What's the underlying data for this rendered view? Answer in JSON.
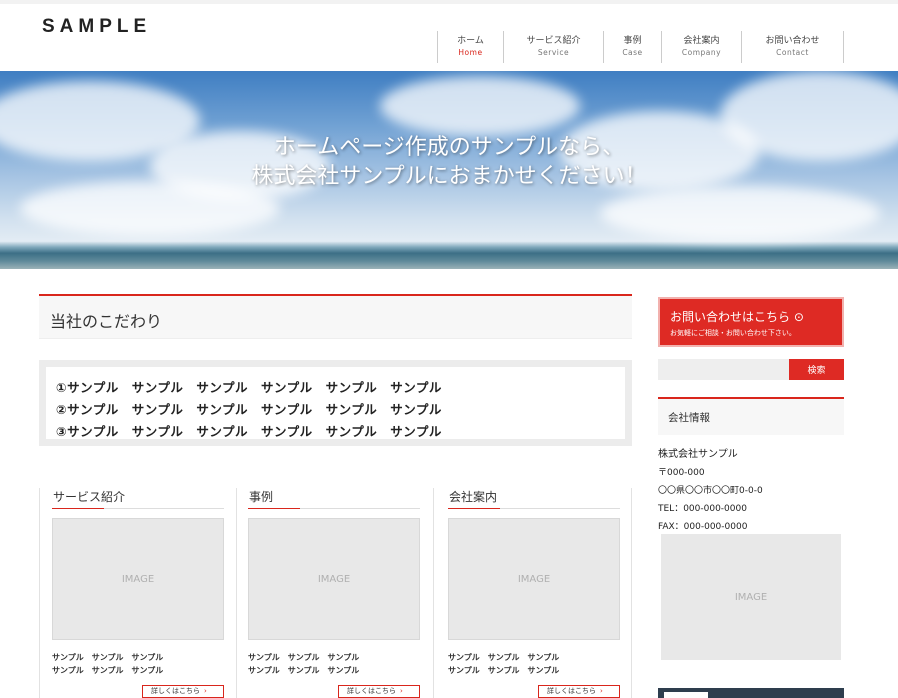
{
  "header": {
    "logo": "SAMPLE",
    "nav": [
      {
        "jp": "ホーム",
        "en": "Home",
        "active": true
      },
      {
        "jp": "サービス紹介",
        "en": "Service",
        "active": false
      },
      {
        "jp": "事例",
        "en": "Case",
        "active": false
      },
      {
        "jp": "会社案内",
        "en": "Company",
        "active": false
      },
      {
        "jp": "お問い合わせ",
        "en": "Contact",
        "active": false
      }
    ]
  },
  "hero": {
    "line1": "ホームページ作成のサンプルなら、",
    "line2": "株式会社サンプルにおまかせください！"
  },
  "main": {
    "section_title": "当社のこだわり",
    "sample_lines": [
      "①サンプル　サンプル　サンプル　サンプル　サンプル　サンプル",
      "②サンプル　サンプル　サンプル　サンプル　サンプル　サンプル",
      "③サンプル　サンプル　サンプル　サンプル　サンプル　サンプル"
    ],
    "columns": [
      {
        "title": "サービス紹介",
        "image": "IMAGE",
        "text1": "サンプル　サンプル　サンプル",
        "text2": "サンプル　サンプル　サンプル",
        "more": "詳しくはこちら"
      },
      {
        "title": "事例",
        "image": "IMAGE",
        "text1": "サンプル　サンプル　サンプル",
        "text2": "サンプル　サンプル　サンプル",
        "more": "詳しくはこちら"
      },
      {
        "title": "会社案内",
        "image": "IMAGE",
        "text1": "サンプル　サンプル　サンプル",
        "text2": "サンプル　サンプル　サンプル",
        "more": "詳しくはこちら"
      }
    ]
  },
  "sidebar": {
    "contact_title": "お問い合わせはこちら ⊙",
    "contact_sub": "お気軽にご相談・お問い合わせ下さい。",
    "search_button": "検索",
    "company_head": "会社情報",
    "company_name": "株式会社サンプル",
    "postal": "〒000-000",
    "address": "〇〇県〇〇市〇〇町0-0-0",
    "tel": "TEL：000-000-0000",
    "fax": "FAX：000-000-0000",
    "image": "IMAGE"
  },
  "colors": {
    "accent": "#d9261c"
  }
}
